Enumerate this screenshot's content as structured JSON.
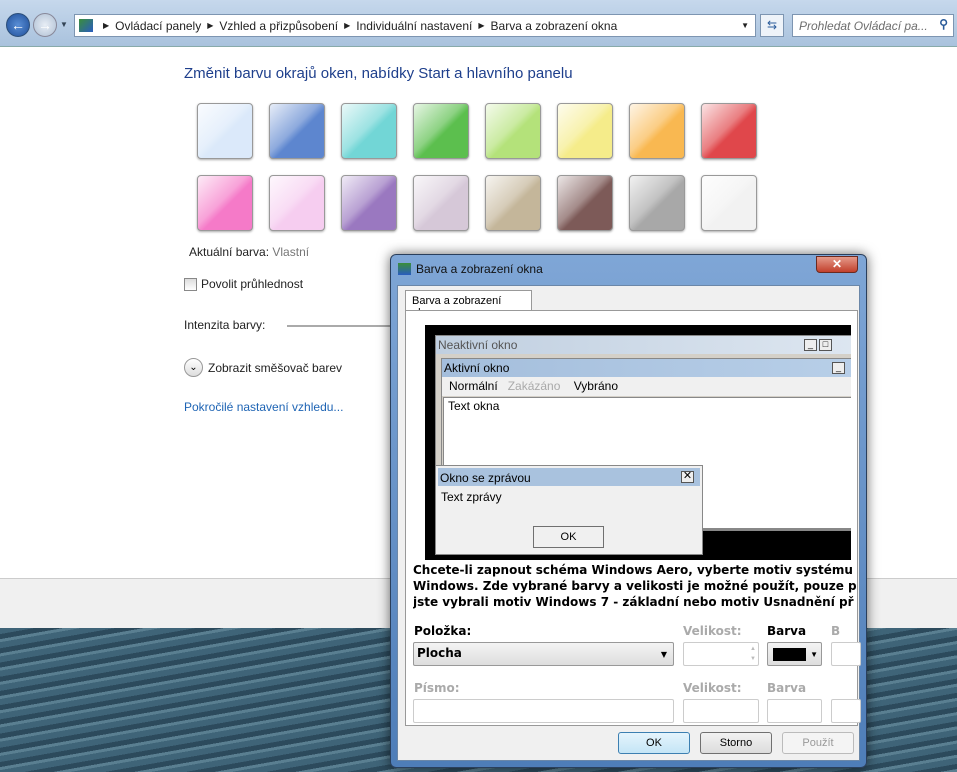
{
  "nav": {
    "back": "back",
    "forward": "forward",
    "breadcrumb": [
      "Ovládací panely",
      "Vzhled a přizpůsobení",
      "Individuální nastavení",
      "Barva a zobrazení okna"
    ],
    "search_placeholder": "Prohledat Ovládací pa..."
  },
  "main": {
    "title": "Změnit barvu okrajů oken, nabídky Start a hlavního panelu",
    "swatches": [
      "#dbe9fa",
      "#5d86cf",
      "#72d6d6",
      "#5cbf4e",
      "#b4e27a",
      "#f5ec8a",
      "#f9b851",
      "#e0474b",
      "#f57ac8",
      "#f6cdf0",
      "#9a78c0",
      "#d6c8d8",
      "#c4b69a",
      "#7d5a58",
      "#a8a8a8",
      "#f2f2f2"
    ],
    "current_label": "Aktuální barva:",
    "current_value": "Vlastní",
    "transparency_label": "Povolit průhlednost",
    "transparency_checked": false,
    "intensity_label": "Intenzita barvy:",
    "mixer_label": "Zobrazit směšovač barev",
    "advanced_link": "Pokročilé nastavení vzhledu..."
  },
  "dialog": {
    "title": "Barva a zobrazení okna",
    "tab": "Barva a zobrazení okna",
    "preview": {
      "inactive": "Neaktivní okno",
      "active": "Aktivní okno",
      "menu": [
        "Normální",
        "Zakázáno",
        "Vybráno"
      ],
      "window_text": "Text okna",
      "msgbox_title": "Okno se zprávou",
      "msgbox_text": "Text zprávy",
      "ok": "OK"
    },
    "info": [
      "Chcete-li zapnout schéma Windows Aero, vyberte motiv systému",
      "Windows. Zde vybrané barvy a velikosti je možné použít, pouze p",
      "jste vybrali motiv Windows 7 - základní nebo motiv Usnadnění př"
    ],
    "item_label": "Položka:",
    "item_value": "Plocha",
    "size_label": "Velikost:",
    "color_label": "Barva",
    "color2_label": "B",
    "item_color": "#000000",
    "font_label": "Písmo:",
    "font_size_label": "Velikost:",
    "font_color_label": "Barva",
    "ok": "OK",
    "cancel": "Storno",
    "apply": "Použít"
  }
}
